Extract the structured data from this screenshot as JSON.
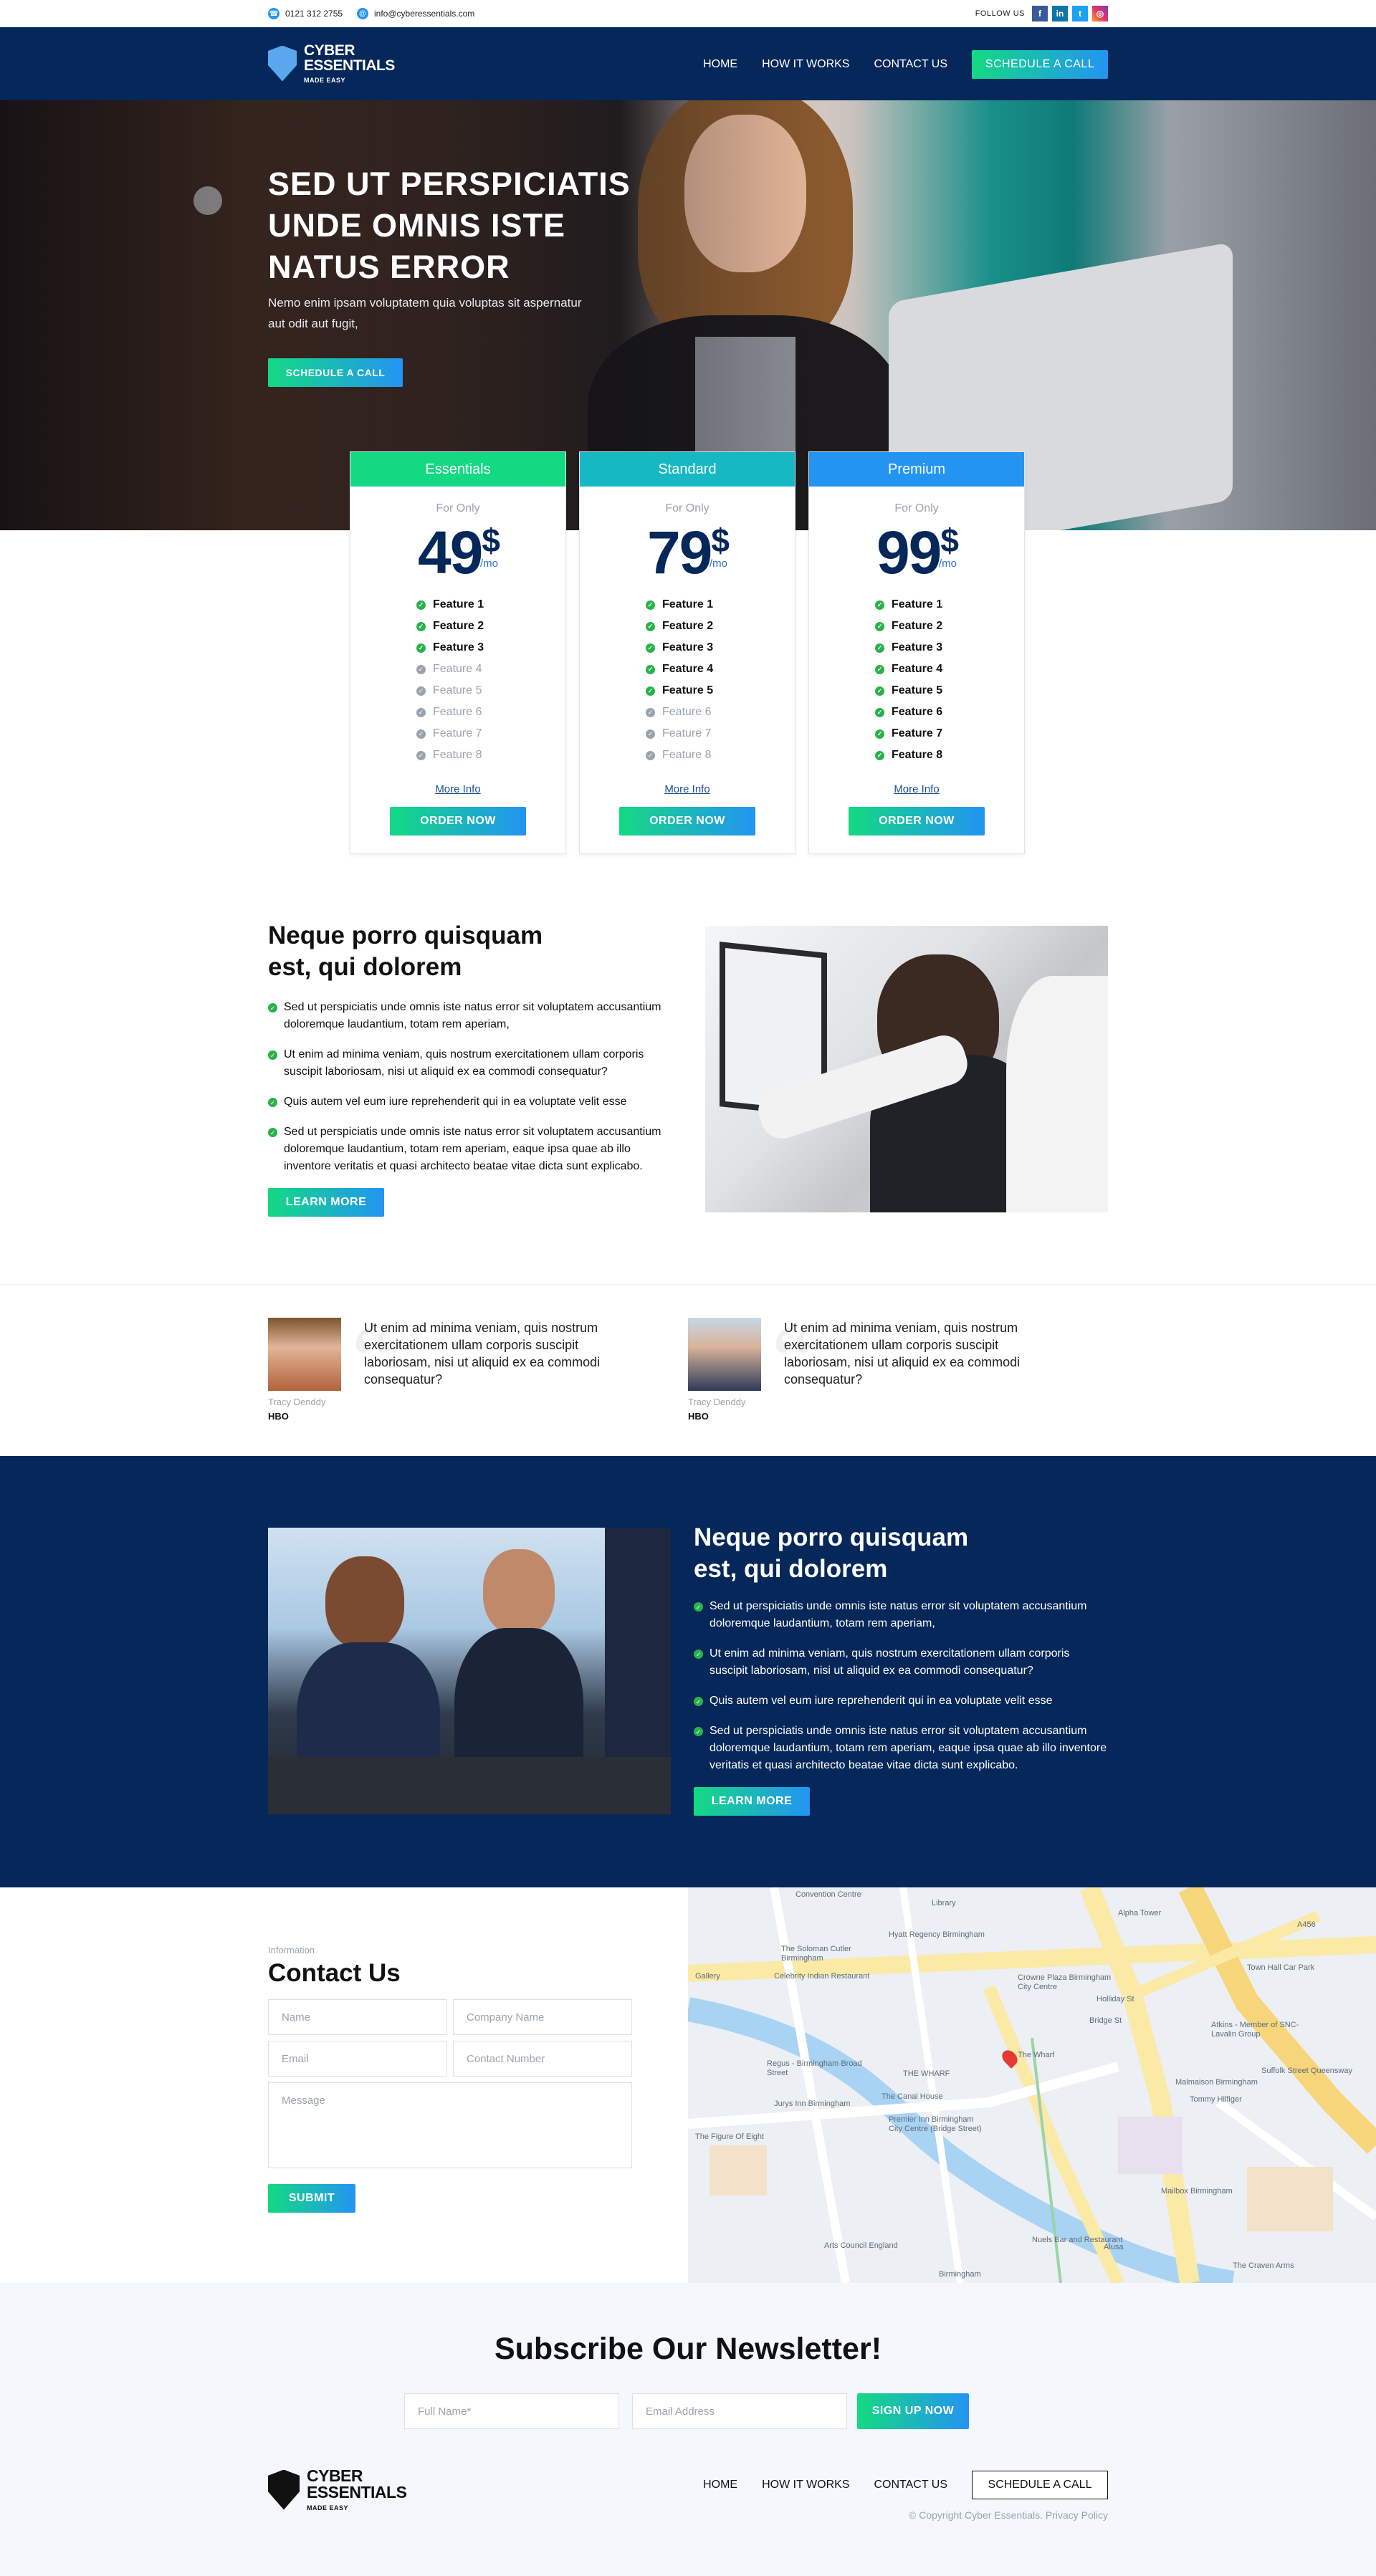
{
  "topbar": {
    "phone": "0121 312 2755",
    "email": "info@cyberessentials.com",
    "follow_label": "FOLLOW US",
    "social": [
      "facebook-icon",
      "linkedin-icon",
      "twitter-icon",
      "instagram-icon"
    ]
  },
  "brand": {
    "line1": "CYBER",
    "line2": "ESSENTIALS",
    "tagline": "MADE EASY"
  },
  "nav": {
    "items": [
      "HOME",
      "HOW IT WORKS",
      "CONTACT US"
    ],
    "cta": "SCHEDULE A CALL"
  },
  "hero": {
    "title": "SED UT PERSPICIATIS UNDE OMNIS ISTE NATUS ERROR",
    "subtitle": "Nemo enim ipsam voluptatem quia voluptas sit aspernatur aut odit aut fugit,",
    "cta": "SCHEDULE A CALL"
  },
  "pricing": {
    "plans": [
      {
        "name": "Essentials",
        "color": "#14d983",
        "for_only": "For Only",
        "price": "49",
        "currency": "$",
        "period": "/mo",
        "features": [
          "Feature 1",
          "Feature 2",
          "Feature 3",
          "Feature 4",
          "Feature 5",
          "Feature 6",
          "Feature 7",
          "Feature 8"
        ],
        "included": 3,
        "more": "More Info",
        "order": "ORDER NOW"
      },
      {
        "name": "Standard",
        "color": "#16b8c4",
        "for_only": "For Only",
        "price": "79",
        "currency": "$",
        "period": "/mo",
        "features": [
          "Feature 1",
          "Feature 2",
          "Feature 3",
          "Feature 4",
          "Feature 5",
          "Feature 6",
          "Feature 7",
          "Feature 8"
        ],
        "included": 5,
        "more": "More Info",
        "order": "ORDER NOW"
      },
      {
        "name": "Premium",
        "color": "#2394f2",
        "for_only": "For Only",
        "price": "99",
        "currency": "$",
        "period": "/mo",
        "features": [
          "Feature 1",
          "Feature 2",
          "Feature 3",
          "Feature 4",
          "Feature 5",
          "Feature 6",
          "Feature 7",
          "Feature 8"
        ],
        "included": 8,
        "more": "More Info",
        "order": "ORDER NOW"
      }
    ]
  },
  "feature1": {
    "title_l1": "Neque porro quisquam",
    "title_l2": "est, qui dolorem",
    "bullets": [
      "Sed ut perspiciatis unde omnis iste natus error sit voluptatem accusantium doloremque laudantium, totam rem aperiam,",
      "Ut enim ad minima veniam, quis nostrum exercitationem ullam corporis suscipit laboriosam, nisi ut aliquid ex ea commodi consequatur?",
      "Quis autem vel eum iure reprehenderit qui in ea voluptate velit esse",
      "Sed ut perspiciatis unde omnis iste natus error sit voluptatem accusantium doloremque laudantium, totam rem aperiam, eaque ipsa quae ab illo inventore veritatis et quasi architecto beatae vitae dicta sunt explicabo."
    ],
    "cta": "LEARN MORE"
  },
  "testimonials": [
    {
      "quote": "Ut enim ad minima veniam, quis nostrum exercitationem ullam corporis suscipit laboriosam, nisi ut aliquid ex ea commodi consequatur?",
      "name": "Tracy Denddy",
      "company": "HBO"
    },
    {
      "quote": "Ut enim ad minima veniam, quis nostrum exercitationem ullam corporis suscipit laboriosam, nisi ut aliquid ex ea commodi consequatur?",
      "name": "Tracy Denddy",
      "company": "HBO"
    }
  ],
  "feature2": {
    "title_l1": "Neque porro quisquam",
    "title_l2": "est, qui dolorem",
    "bullets": [
      "Sed ut perspiciatis unde omnis iste natus error sit voluptatem accusantium doloremque laudantium, totam rem aperiam,",
      "Ut enim ad minima veniam, quis nostrum exercitationem ullam corporis suscipit laboriosam, nisi ut aliquid ex ea commodi consequatur?",
      "Quis autem vel eum iure reprehenderit qui in ea voluptate velit esse",
      "Sed ut perspiciatis unde omnis iste natus error sit voluptatem accusantium doloremque laudantium, totam rem aperiam, eaque ipsa quae ab illo inventore veritatis et quasi architecto beatae vitae dicta sunt explicabo."
    ],
    "cta": "LEARN MORE"
  },
  "contact": {
    "eyebrow": "Information",
    "title": "Contact Us",
    "fields": {
      "name": "Name",
      "company": "Company Name",
      "email": "Email",
      "number": "Contact Number",
      "message": "Message"
    },
    "submit": "SUBMIT"
  },
  "map": {
    "labels": [
      "Convention Centre",
      "Library",
      "Alpha Tower",
      "The Soloman Cutler Birmingham",
      "Hyatt Regency Birmingham",
      "Crowne Plaza Birmingham City Centre",
      "Town Hall Car Park",
      "Celebrity Indian Restaurant",
      "Gallery",
      "Atkins - Member of SNC-Lavalin Group",
      "The Wharf",
      "Regus - Birmingham Broad Street",
      "THE WHARF",
      "The Canal House",
      "Malmaison Birmingham",
      "Tommy Hilfiger",
      "Jurys Inn Birmingham",
      "Premier Inn Birmingham City Centre (Bridge Street)",
      "The Figure Of Eight",
      "Mailbox Birmingham",
      "Arts Council England",
      "Nuels Bar and Restaurant",
      "Alusa",
      "The Craven Arms",
      "Birmingham",
      "Holliday St",
      "Suffolk Street Queensway",
      "A456",
      "Bridge St"
    ],
    "pin_label": "The Wharf"
  },
  "newsletter": {
    "title": "Subscribe Our Newsletter!",
    "name_placeholder": "Full Name*",
    "email_placeholder": "Email Address",
    "cta": "SIGN UP NOW"
  },
  "footer": {
    "items": [
      "HOME",
      "HOW IT WORKS",
      "CONTACT US"
    ],
    "cta": "SCHEDULE A CALL",
    "copyright": "© Copyright Cyber Essentials. Privacy Policy"
  }
}
